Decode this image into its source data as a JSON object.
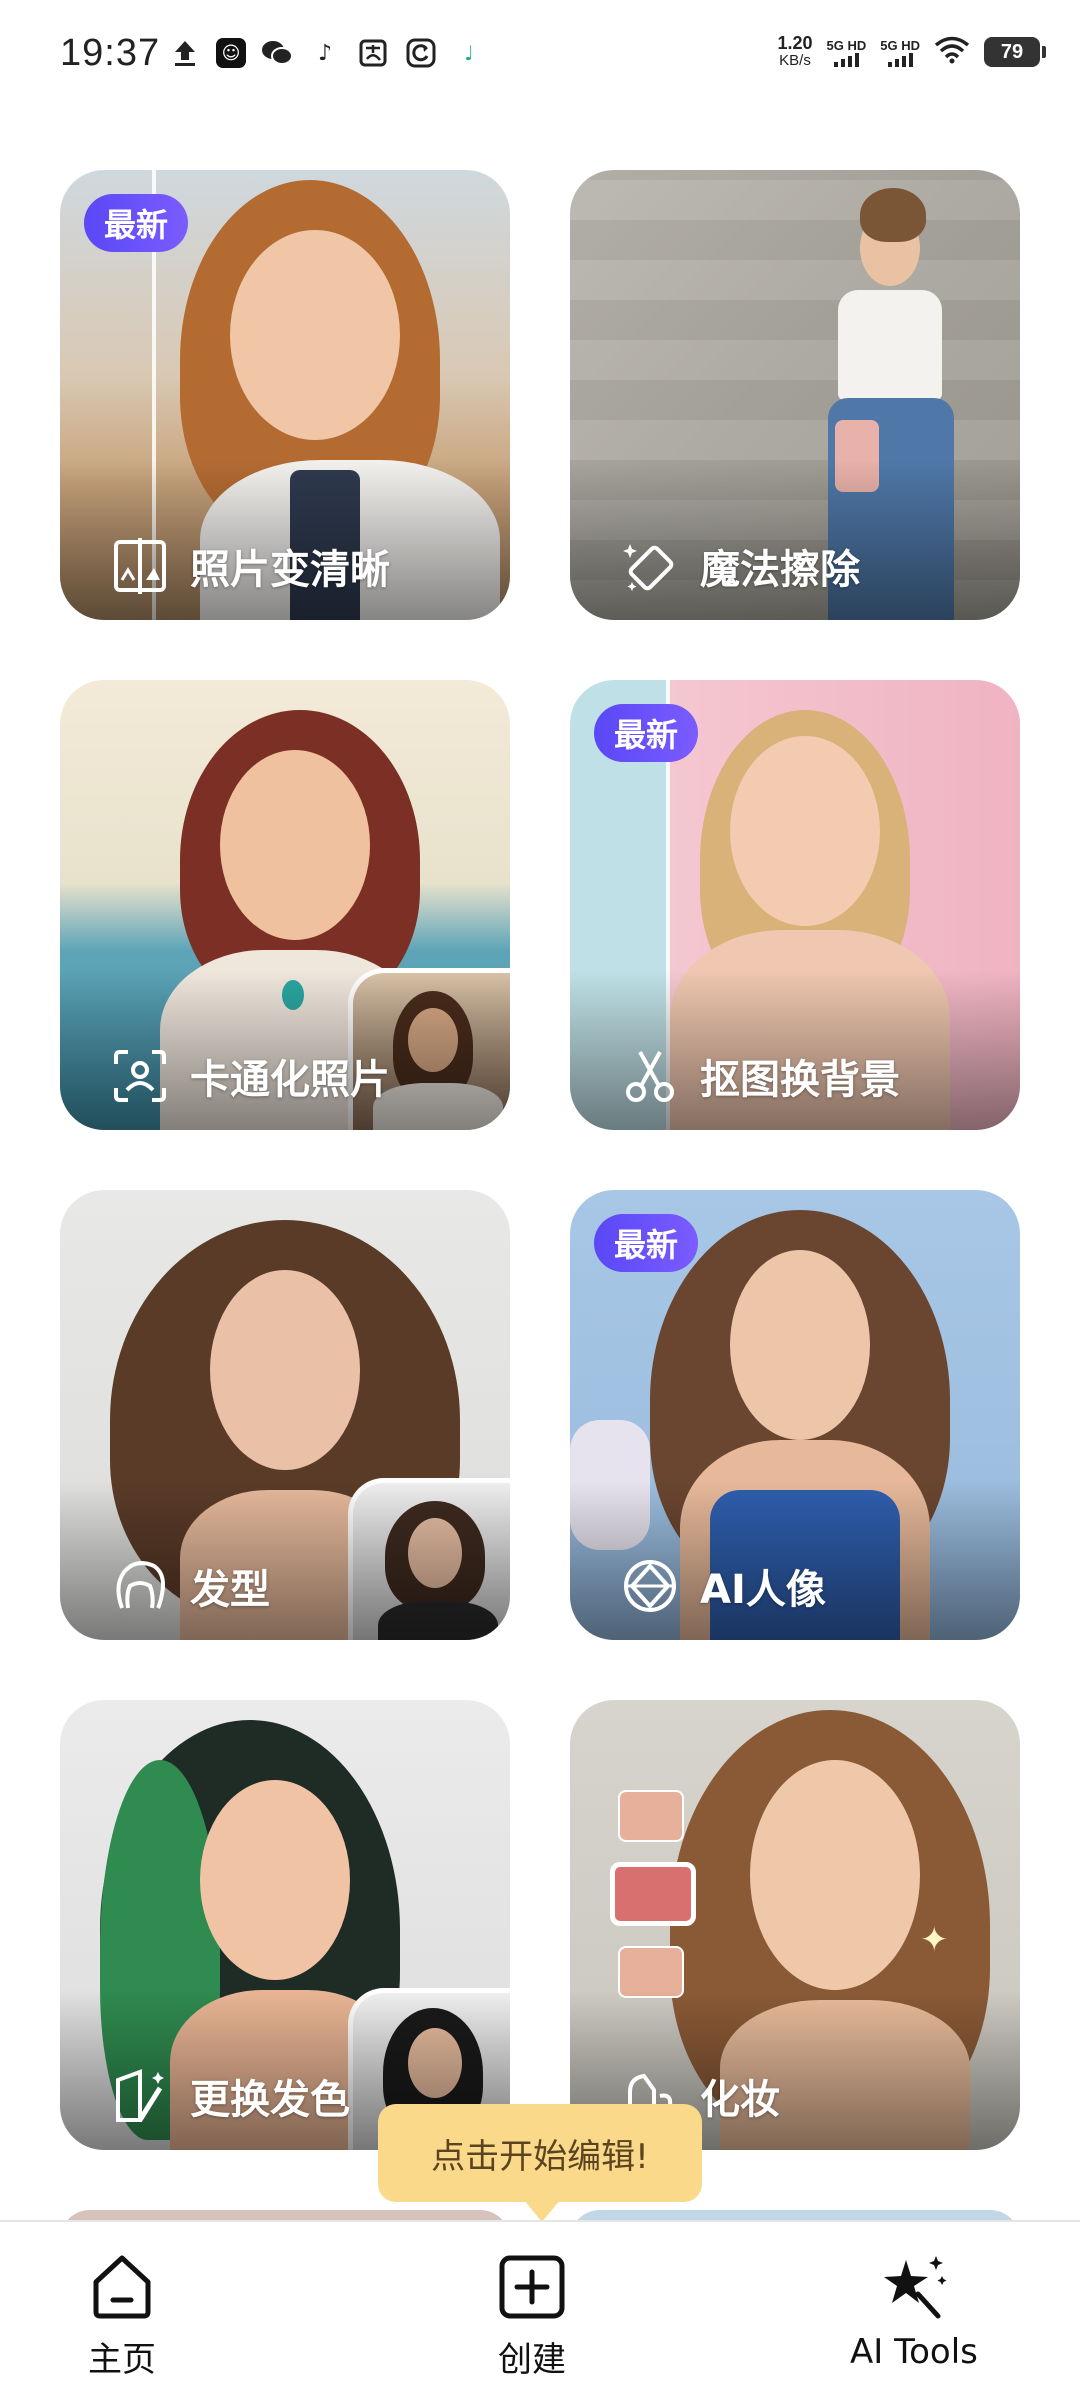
{
  "status_bar": {
    "time": "19:37",
    "net_speed_value": "1.20",
    "net_speed_unit": "KB/s",
    "sim1": "5G HD",
    "sim2": "5G HD",
    "battery": "79",
    "icons": [
      "upload-icon",
      "app-icon",
      "wechat-icon",
      "tiktok-icon",
      "alipay-icon",
      "refresh-app-icon",
      "music-icon"
    ]
  },
  "cards": [
    {
      "label": "照片变清晰",
      "badge": "最新",
      "icon": "enhance-photo-icon"
    },
    {
      "label": "魔法擦除",
      "badge": "",
      "icon": "magic-eraser-icon"
    },
    {
      "label": "卡通化照片",
      "badge": "",
      "icon": "face-scan-icon"
    },
    {
      "label": "抠图换背景",
      "badge": "最新",
      "icon": "scissors-icon"
    },
    {
      "label": "发型",
      "badge": "",
      "icon": "hairstyle-icon"
    },
    {
      "label": "AI人像",
      "badge": "最新",
      "icon": "ai-portrait-icon"
    },
    {
      "label": "更换发色",
      "badge": "",
      "icon": "hair-color-icon"
    },
    {
      "label": "化妆",
      "badge": "",
      "icon": "makeup-icon"
    }
  ],
  "tooltip": "点击开始编辑!",
  "nav": {
    "home": "主页",
    "create": "创建",
    "ai_tools": "AI Tools"
  }
}
